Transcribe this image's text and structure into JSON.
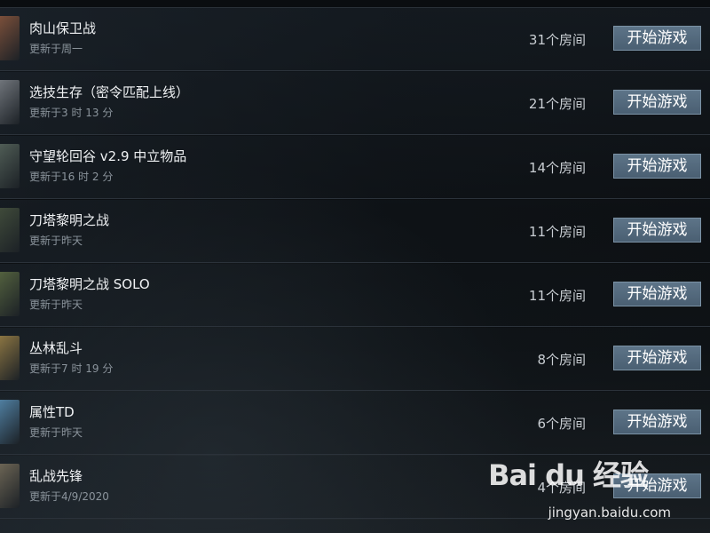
{
  "games": [
    {
      "name": "肉山保卫战",
      "updated": "更新于周一",
      "rooms": "31个房间",
      "button": "开始游戏",
      "thumb_color": "#7a4f3a"
    },
    {
      "name": "选技生存（密令匹配上线）",
      "updated": "更新于3 时 13 分",
      "rooms": "21个房间",
      "button": "开始游戏",
      "thumb_color": "#6f747a"
    },
    {
      "name": "守望轮回谷 v2.9 中立物品",
      "updated": "更新于16 时 2 分",
      "rooms": "14个房间",
      "button": "开始游戏",
      "thumb_color": "#4f5c55"
    },
    {
      "name": "刀塔黎明之战",
      "updated": "更新于昨天",
      "rooms": "11个房间",
      "button": "开始游戏",
      "thumb_color": "#3f4a3a"
    },
    {
      "name": "刀塔黎明之战 SOLO",
      "updated": "更新于昨天",
      "rooms": "11个房间",
      "button": "开始游戏",
      "thumb_color": "#52603e"
    },
    {
      "name": "丛林乱斗",
      "updated": "更新于7 时 19 分",
      "rooms": "8个房间",
      "button": "开始游戏",
      "thumb_color": "#8a7442"
    },
    {
      "name": "属性TD",
      "updated": "更新于昨天",
      "rooms": "6个房间",
      "button": "开始游戏",
      "thumb_color": "#4f7ea0"
    },
    {
      "name": "乱战先锋",
      "updated": "更新于4/9/2020",
      "rooms": "4个房间",
      "button": "开始游戏",
      "thumb_color": "#6b6454"
    }
  ],
  "watermark": {
    "logo": "Bai du 经验",
    "url": "jingyan.baidu.com"
  }
}
